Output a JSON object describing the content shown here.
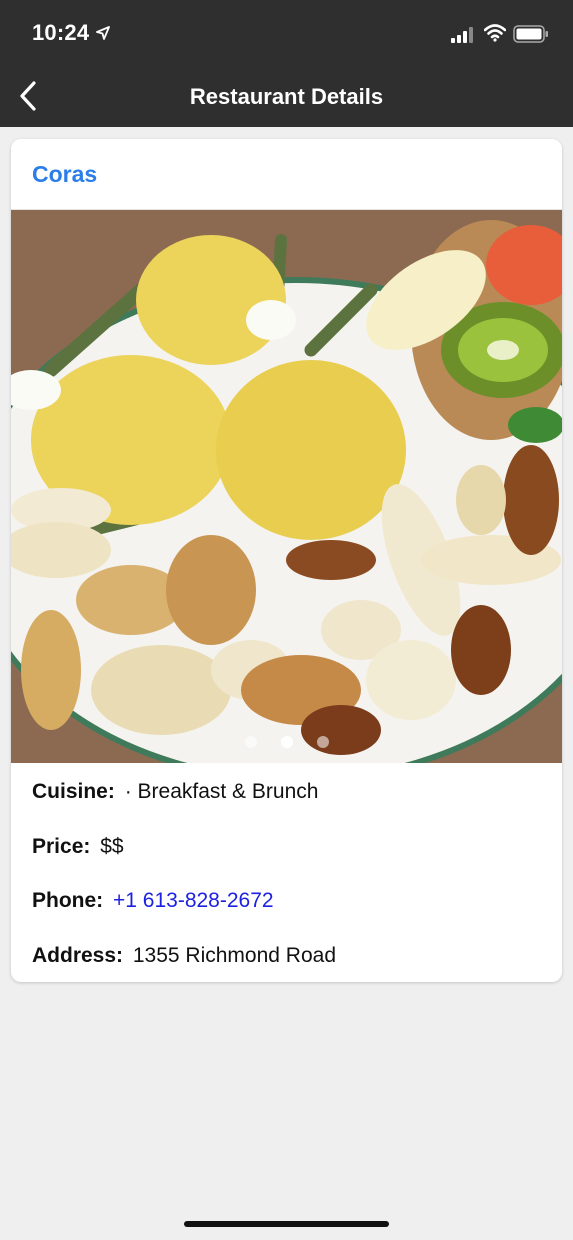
{
  "status_bar": {
    "time": "10:24",
    "icons": [
      "location-arrow-icon",
      "signal-icon",
      "wifi-icon",
      "battery-icon"
    ]
  },
  "nav": {
    "title": "Restaurant Details",
    "back_icon": "chevron-left-icon"
  },
  "restaurant": {
    "name": "Coras",
    "photo": {
      "description_icon": "food-photo",
      "pager_count": 3,
      "active_index": 1
    },
    "cuisine": {
      "label": "Cuisine:",
      "value": "· Breakfast & Brunch"
    },
    "price": {
      "label": "Price:",
      "value": "$$"
    },
    "phone": {
      "label": "Phone:",
      "value": "+1 613-828-2672"
    },
    "address": {
      "label": "Address:",
      "value": "1355 Richmond Road"
    }
  },
  "colors": {
    "bar_background": "#2f2f2f",
    "title_blue": "#2b7de9",
    "link_blue": "#1d22e0",
    "page_background": "#efefef"
  }
}
